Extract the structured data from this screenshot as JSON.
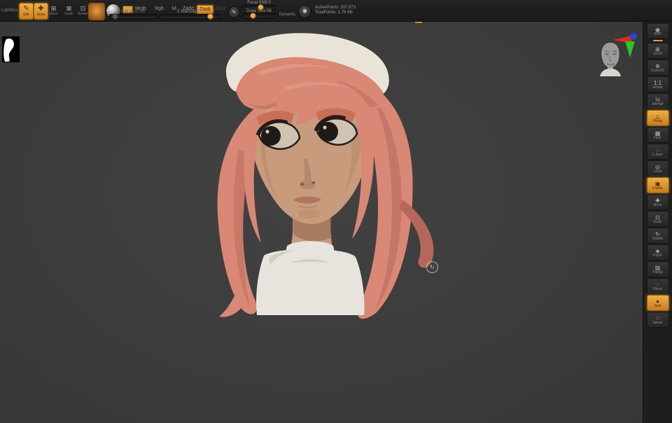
{
  "app": {
    "accent": "#e09a36"
  },
  "top_shelf": {
    "lightbox_label": "LightBox",
    "edit": {
      "label": "Edit",
      "glyph": "✎"
    },
    "draw": {
      "label": "Draw",
      "glyph": "✚"
    },
    "move": {
      "label": "Move",
      "glyph": "⊞"
    },
    "scale": {
      "label": "Scale",
      "glyph": "⊠"
    },
    "rotate": {
      "label": "Rotate",
      "glyph": "⊡"
    },
    "sculptris_glyph": "✎",
    "stats_glyph": "✱",
    "current_color": "#e09a36",
    "modes": {
      "mrgb": "Mrgb",
      "rgb": "Rgb",
      "m": "M",
      "zadd": "Zadd",
      "zsub": "Zsub",
      "zcut": "Zcut"
    },
    "sliders": {
      "rgb_intensity": {
        "label": "Rgb Intensity"
      },
      "z_intensity": {
        "label": "Z Intensity 30"
      },
      "focal_shift": {
        "label": "Focal Shift 0"
      },
      "draw_size": {
        "label": "Draw Size 96"
      }
    },
    "dynamic_label": "Dynamic",
    "stats": {
      "active_points": "ActivePoints: 107,873",
      "total_points": "TotalPoints: 1.76 Mil"
    }
  },
  "right_shelf": {
    "items": [
      {
        "caption": "BPR",
        "glyph": "◉",
        "active": false
      },
      {
        "caption": "Scroll",
        "glyph": "⊞",
        "active": false
      },
      {
        "caption": "Zoom3D",
        "glyph": "⊕",
        "active": false
      },
      {
        "caption": "Actual",
        "glyph": "1:1",
        "active": false
      },
      {
        "caption": "AAHalf",
        "glyph": "½",
        "active": false
      },
      {
        "caption": "Persp",
        "glyph": "△",
        "active": true
      },
      {
        "caption": "Floor",
        "glyph": "▦",
        "active": false
      },
      {
        "caption": "L.Sym",
        "glyph": "∴",
        "active": false
      },
      {
        "caption": "Local",
        "glyph": "◎",
        "active": false
      },
      {
        "caption": "Frame",
        "glyph": "▣",
        "active": true
      },
      {
        "caption": "Move",
        "glyph": "✚",
        "active": false
      },
      {
        "caption": "Scale",
        "glyph": "⊡",
        "active": false
      },
      {
        "caption": "Rotate",
        "glyph": "↻",
        "active": false
      },
      {
        "caption": "PolyF",
        "glyph": "◈",
        "active": false
      },
      {
        "caption": "Transp",
        "glyph": "▨",
        "active": false
      },
      {
        "caption": "Ghost",
        "glyph": "◌",
        "active": false
      },
      {
        "caption": "Solo",
        "glyph": "●",
        "active": true
      },
      {
        "caption": "Xpose",
        "glyph": "∷",
        "active": false
      }
    ]
  },
  "canvas": {
    "cursor_glyph": "↻",
    "gizmo": {
      "x_color": "#e0281a",
      "y_color": "#2dc228",
      "z_color": "#2b43d8"
    },
    "character": {
      "hair": "#d98875",
      "hair_dark": "#b5685a",
      "hair_light": "#e8a38f",
      "skin": "#c89b7d",
      "skin_shadow": "#9c7055",
      "beret": "#eae4d8",
      "beret_shadow": "#c9c2b4",
      "shirt": "#e7e4de",
      "shirt_shadow": "#c4c0b8",
      "eye": "#1f1a18",
      "sclera": "#cfc3b2",
      "brow": "#c96f58",
      "lip": "#b0765c"
    }
  }
}
